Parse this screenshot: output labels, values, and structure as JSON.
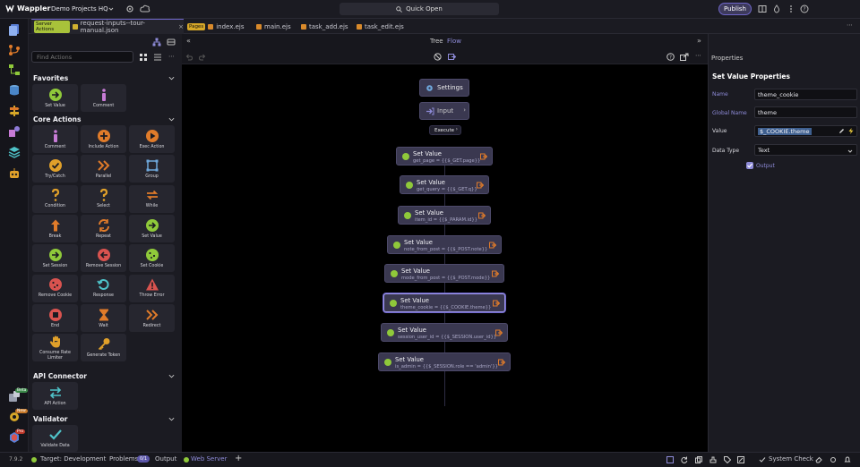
{
  "app": {
    "name": "Wappler",
    "project": "Demo Projects HQ",
    "quick_open": "Quick Open",
    "publish": "Publish"
  },
  "tabs": [
    {
      "tag": "Server Actions",
      "label": "request-inputs--tour-manual.json"
    },
    {
      "tag": "Pages",
      "label": "index.ejs"
    },
    {
      "label": "main.ejs"
    },
    {
      "label": "task_add.ejs"
    },
    {
      "label": "task_edit.ejs"
    }
  ],
  "actions_panel": {
    "search_placeholder": "Find Actions",
    "favorites": {
      "title": "Favorites",
      "items": [
        "Set Value",
        "Comment"
      ]
    },
    "core": {
      "title": "Core Actions",
      "items": [
        "Comment",
        "Include Action",
        "Exec Action",
        "Try/Catch",
        "Parallel",
        "Group",
        "Condition",
        "Select",
        "While",
        "Break",
        "Repeat",
        "Set Value",
        "Set Session",
        "Remove Session",
        "Set Cookie",
        "Remove Cookie",
        "Response",
        "Throw Error",
        "End",
        "Wait",
        "Redirect",
        "Consume Rate Limiter",
        "Generate Token"
      ]
    },
    "api": {
      "title": "API Connector",
      "items": [
        "API Action"
      ]
    },
    "validator": {
      "title": "Validator",
      "items": [
        "Validate Data"
      ]
    }
  },
  "canvas": {
    "view_tree": "Tree",
    "view_flow": "Flow",
    "settings": "Settings",
    "input": "Input",
    "execute": "Execute",
    "nodes": [
      {
        "title": "Set Value",
        "expr": "get_page = {{$_GET.page}}"
      },
      {
        "title": "Set Value",
        "expr": "get_query = {{$_GET.q}}"
      },
      {
        "title": "Set Value",
        "expr": "item_id = {{$_PARAM.id}}"
      },
      {
        "title": "Set Value",
        "expr": "note_from_post = {{$_POST.note}}"
      },
      {
        "title": "Set Value",
        "expr": "mode_from_post = {{$_POST.mode}}"
      },
      {
        "title": "Set Value",
        "expr": "theme_cookie = {{$_COOKIE.theme}}"
      },
      {
        "title": "Set Value",
        "expr": "session_user_id = {{$_SESSION.user_id}}"
      },
      {
        "title": "Set Value",
        "expr": "is_admin = {{$_SESSION.role == 'admin'}}"
      }
    ]
  },
  "properties": {
    "header": "Properties",
    "title": "Set Value Properties",
    "name_label": "Name",
    "name_value": "theme_cookie",
    "global_label": "Global Name",
    "global_value": "theme",
    "value_label": "Value",
    "value_value": "$_COOKIE.theme",
    "type_label": "Data Type",
    "type_value": "Text",
    "output_label": "Output"
  },
  "status": {
    "version": "7.9.2",
    "target": "Target: Development",
    "problems": "Problems",
    "problems_count": "0/1",
    "output": "Output",
    "web_server": "Web Server",
    "system_check": "System Check"
  },
  "colors": {
    "accent": "#6e66c9",
    "green": "#8fc93a",
    "orange": "#e07b2a",
    "red": "#d9534f"
  }
}
